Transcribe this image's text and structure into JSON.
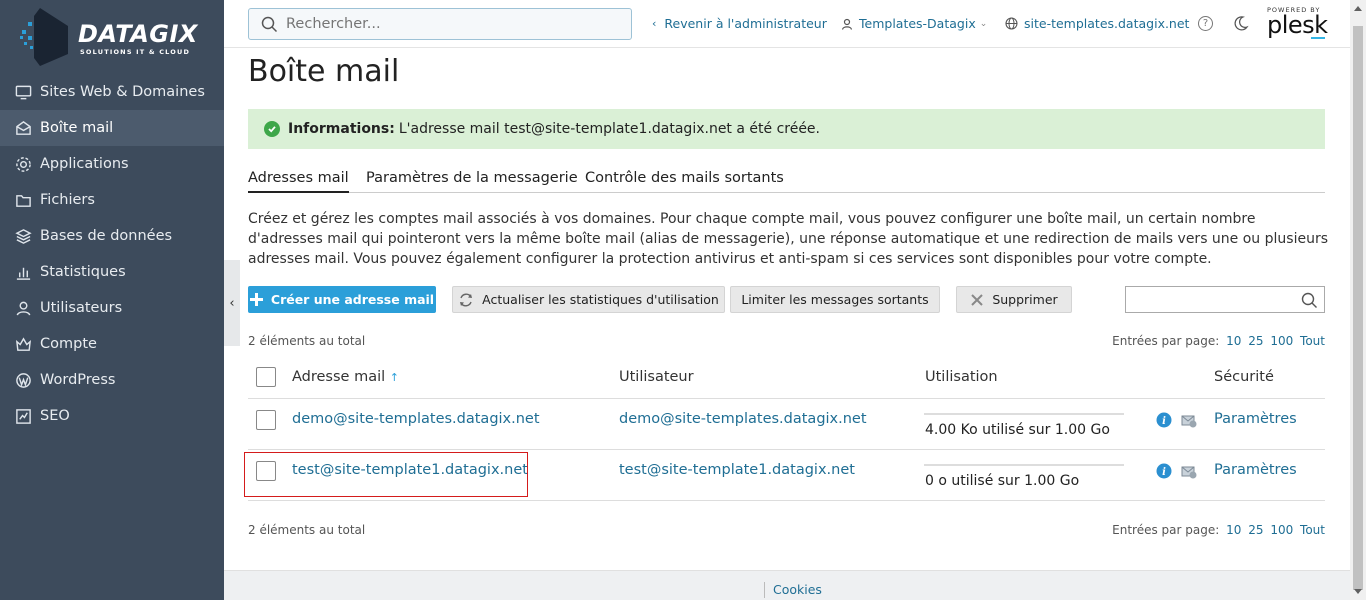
{
  "brand": {
    "name": "DATAGIX",
    "tagline": "SOLUTIONS IT & CLOUD",
    "plesk_powered": "POWERED BY",
    "plesk_name": "plesk"
  },
  "sidebar": {
    "items": [
      {
        "label": "Sites Web & Domaines",
        "icon": "monitor-icon"
      },
      {
        "label": "Boîte mail",
        "icon": "mail-icon",
        "active": true
      },
      {
        "label": "Applications",
        "icon": "gear-icon"
      },
      {
        "label": "Fichiers",
        "icon": "folder-icon"
      },
      {
        "label": "Bases de données",
        "icon": "database-icon"
      },
      {
        "label": "Statistiques",
        "icon": "bar-chart-icon"
      },
      {
        "label": "Utilisateurs",
        "icon": "user-icon"
      },
      {
        "label": "Compte",
        "icon": "crown-icon"
      },
      {
        "label": "WordPress",
        "icon": "wordpress-icon"
      },
      {
        "label": "SEO",
        "icon": "seo-icon"
      }
    ],
    "collapse_glyph": "‹"
  },
  "header": {
    "search_placeholder": "Rechercher...",
    "back_admin": "Revenir à l'administrateur",
    "user": "Templates-Datagix",
    "domain": "site-templates.datagix.net",
    "help": "?"
  },
  "page": {
    "title": "Boîte mail",
    "info_label": "Informations:",
    "info_text": "L'adresse mail test@site-template1.datagix.net a été créée.",
    "tabs": [
      "Adresses mail",
      "Paramètres de la messagerie",
      "Contrôle des mails sortants"
    ],
    "description": "Créez et gérez les comptes mail associés à vos domaines. Pour chaque compte mail, vous pouvez configurer une boîte mail, un certain nombre d'adresses mail qui pointeront vers la même boîte mail (alias de messagerie), une réponse automatique et une redirection de mails vers une ou plusieurs adresses mail. Vous pouvez également configurer la protection antivirus et anti-spam si ces services sont disponibles pour votre compte."
  },
  "toolbar": {
    "create": "Créer une adresse mail",
    "refresh_stats": "Actualiser les statistiques d'utilisation",
    "limit_outgoing": "Limiter les messages sortants",
    "delete": "Supprimer"
  },
  "list": {
    "total": "2 éléments au total",
    "per_page_label": "Entrées par page:",
    "per_page_options": [
      "10",
      "25",
      "100",
      "Tout"
    ],
    "columns": {
      "address": "Adresse mail",
      "sort_arrow": "↑",
      "user": "Utilisateur",
      "usage": "Utilisation",
      "security": "Sécurité"
    },
    "rows": [
      {
        "address": "demo@site-templates.datagix.net",
        "user": "demo@site-templates.datagix.net",
        "usage": "4.00 Ko utilisé sur 1.00 Go",
        "usage_fraction": 0.0,
        "security": "Paramètres"
      },
      {
        "address": "test@site-template1.datagix.net",
        "user": "test@site-template1.datagix.net",
        "usage": "0 o utilisé sur 1.00 Go",
        "usage_fraction": 0.0,
        "security": "Paramètres"
      }
    ]
  },
  "footer": {
    "cookies": "Cookies"
  },
  "colors": {
    "sidebar_bg": "#3d4b5c",
    "accent": "#2b9fd9",
    "link": "#1f6e94",
    "success_bg": "#daf0d6",
    "highlight": "#d41b1b"
  }
}
